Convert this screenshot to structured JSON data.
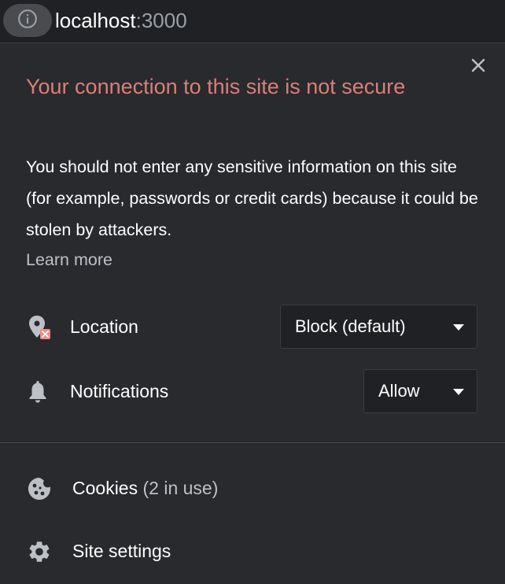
{
  "omnibox": {
    "host": "localhost",
    "port": ":3000",
    "info_icon": "info-circle-icon"
  },
  "popup": {
    "title": "Your connection to this site is not secure",
    "body": "You should not enter any sensitive information on this site (for example, passwords or credit cards) because it could be stolen by attackers.",
    "learn_more": "Learn more",
    "close_icon": "close-icon"
  },
  "permissions": [
    {
      "icon": "location-blocked-icon",
      "label": "Location",
      "value": "Block (default)"
    },
    {
      "icon": "bell-icon",
      "label": "Notifications",
      "value": "Allow"
    }
  ],
  "footer": {
    "cookies_label": "Cookies",
    "cookies_count": "(2 in use)",
    "cookies_icon": "cookie-icon",
    "site_settings_label": "Site settings",
    "site_settings_icon": "gear-icon"
  },
  "colors": {
    "background": "#292a2d",
    "omnibox": "#202124",
    "warning": "#f28b82",
    "text": "#ffffff",
    "muted": "#bdc1c6"
  }
}
